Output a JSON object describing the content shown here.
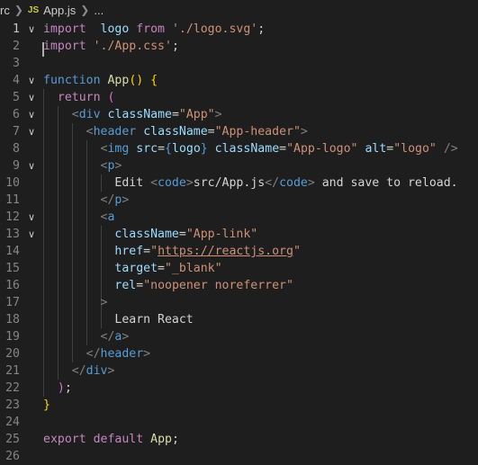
{
  "breadcrumb": {
    "folder": "rc",
    "file_icon": "JS",
    "file": "App.js",
    "ellipsis": "..."
  },
  "editor": {
    "language": "javascript",
    "lines": [
      {
        "n": "1",
        "fold": "v",
        "tokens": [
          [
            "kw",
            "import"
          ],
          [
            "",
            "  "
          ],
          [
            "vr",
            "logo"
          ],
          [
            "",
            ""
          ],
          [
            "kw",
            " from"
          ],
          [
            "",
            " "
          ],
          [
            "st",
            "'./logo.svg'"
          ],
          [
            "",
            ";"
          ]
        ]
      },
      {
        "n": "2",
        "fold": "",
        "tokens": [
          [
            "kw",
            "import"
          ],
          [
            "",
            " "
          ],
          [
            "st",
            "'./App.css'"
          ],
          [
            "",
            ";"
          ]
        ]
      },
      {
        "n": "3",
        "fold": "",
        "tokens": []
      },
      {
        "n": "4",
        "fold": "v",
        "tokens": [
          [
            "kb",
            "function"
          ],
          [
            "",
            " "
          ],
          [
            "fn",
            "App"
          ],
          [
            "br1",
            "()"
          ],
          [
            "",
            " "
          ],
          [
            "br1",
            "{"
          ]
        ]
      },
      {
        "n": "5",
        "fold": "v",
        "tokens": [
          [
            "",
            "  "
          ],
          [
            "kw",
            "return"
          ],
          [
            "",
            " "
          ],
          [
            "br2",
            "("
          ]
        ]
      },
      {
        "n": "6",
        "fold": "v",
        "tokens": [
          [
            "",
            "    "
          ],
          [
            "pu",
            "<"
          ],
          [
            "kb",
            "div"
          ],
          [
            "",
            " "
          ],
          [
            "vr",
            "className"
          ],
          [
            "",
            "="
          ],
          [
            "st",
            "\"App\""
          ],
          [
            "pu",
            ">"
          ]
        ]
      },
      {
        "n": "7",
        "fold": "v",
        "tokens": [
          [
            "",
            "      "
          ],
          [
            "pu",
            "<"
          ],
          [
            "kb",
            "header"
          ],
          [
            "",
            " "
          ],
          [
            "vr",
            "className"
          ],
          [
            "",
            "="
          ],
          [
            "st",
            "\"App-header\""
          ],
          [
            "pu",
            ">"
          ]
        ]
      },
      {
        "n": "8",
        "fold": "",
        "tokens": [
          [
            "",
            "        "
          ],
          [
            "pu",
            "<"
          ],
          [
            "kb",
            "img"
          ],
          [
            "",
            " "
          ],
          [
            "vr",
            "src"
          ],
          [
            "",
            "="
          ],
          [
            "kb",
            "{"
          ],
          [
            "vr",
            "logo"
          ],
          [
            "kb",
            "}"
          ],
          [
            "",
            " "
          ],
          [
            "vr",
            "className"
          ],
          [
            "",
            "="
          ],
          [
            "st",
            "\"App-logo\""
          ],
          [
            "",
            " "
          ],
          [
            "vr",
            "alt"
          ],
          [
            "",
            "="
          ],
          [
            "st",
            "\"logo\""
          ],
          [
            "",
            " "
          ],
          [
            "pu",
            "/>"
          ]
        ]
      },
      {
        "n": "9",
        "fold": "v",
        "tokens": [
          [
            "",
            "        "
          ],
          [
            "pu",
            "<"
          ],
          [
            "kb",
            "p"
          ],
          [
            "pu",
            ">"
          ]
        ]
      },
      {
        "n": "10",
        "fold": "",
        "tokens": [
          [
            "",
            "          Edit "
          ],
          [
            "pu",
            "<"
          ],
          [
            "kb",
            "code"
          ],
          [
            "pu",
            ">"
          ],
          [
            "",
            "src/App.js"
          ],
          [
            "pu",
            "</"
          ],
          [
            "kb",
            "code"
          ],
          [
            "pu",
            ">"
          ],
          [
            "",
            " and save to reload."
          ]
        ]
      },
      {
        "n": "11",
        "fold": "",
        "tokens": [
          [
            "",
            "        "
          ],
          [
            "pu",
            "</"
          ],
          [
            "kb",
            "p"
          ],
          [
            "pu",
            ">"
          ]
        ]
      },
      {
        "n": "12",
        "fold": "v",
        "tokens": [
          [
            "",
            "        "
          ],
          [
            "pu",
            "<"
          ],
          [
            "kb",
            "a"
          ]
        ]
      },
      {
        "n": "13",
        "fold": "v",
        "tokens": [
          [
            "",
            "          "
          ],
          [
            "vr",
            "className"
          ],
          [
            "",
            "="
          ],
          [
            "st",
            "\"App-link\""
          ]
        ]
      },
      {
        "n": "14",
        "fold": "",
        "tokens": [
          [
            "",
            "          "
          ],
          [
            "vr",
            "href"
          ],
          [
            "",
            "="
          ],
          [
            "st",
            "\""
          ],
          [
            "st ul",
            "https://reactjs.org"
          ],
          [
            "st",
            "\""
          ]
        ]
      },
      {
        "n": "15",
        "fold": "",
        "tokens": [
          [
            "",
            "          "
          ],
          [
            "vr",
            "target"
          ],
          [
            "",
            "="
          ],
          [
            "st",
            "\"_blank\""
          ]
        ]
      },
      {
        "n": "16",
        "fold": "",
        "tokens": [
          [
            "",
            "          "
          ],
          [
            "vr",
            "rel"
          ],
          [
            "",
            "="
          ],
          [
            "st",
            "\"noopener noreferrer\""
          ]
        ]
      },
      {
        "n": "17",
        "fold": "",
        "tokens": [
          [
            "",
            "        "
          ],
          [
            "pu",
            ">"
          ]
        ]
      },
      {
        "n": "18",
        "fold": "",
        "tokens": [
          [
            "",
            "          Learn React"
          ]
        ]
      },
      {
        "n": "19",
        "fold": "",
        "tokens": [
          [
            "",
            "        "
          ],
          [
            "pu",
            "</"
          ],
          [
            "kb",
            "a"
          ],
          [
            "pu",
            ">"
          ]
        ]
      },
      {
        "n": "20",
        "fold": "",
        "tokens": [
          [
            "",
            "      "
          ],
          [
            "pu",
            "</"
          ],
          [
            "kb",
            "header"
          ],
          [
            "pu",
            ">"
          ]
        ]
      },
      {
        "n": "21",
        "fold": "",
        "tokens": [
          [
            "",
            "    "
          ],
          [
            "pu",
            "</"
          ],
          [
            "kb",
            "div"
          ],
          [
            "pu",
            ">"
          ]
        ]
      },
      {
        "n": "22",
        "fold": "",
        "tokens": [
          [
            "",
            "  "
          ],
          [
            "br2",
            ")"
          ],
          [
            "",
            ";"
          ]
        ]
      },
      {
        "n": "23",
        "fold": "",
        "tokens": [
          [
            "br1",
            "}"
          ]
        ]
      },
      {
        "n": "24",
        "fold": "",
        "tokens": []
      },
      {
        "n": "25",
        "fold": "",
        "tokens": [
          [
            "kw",
            "export"
          ],
          [
            "",
            " "
          ],
          [
            "kw",
            "default"
          ],
          [
            "",
            " "
          ],
          [
            "fn",
            "App"
          ],
          [
            "",
            ";"
          ]
        ]
      },
      {
        "n": "26",
        "fold": "",
        "tokens": []
      }
    ]
  }
}
